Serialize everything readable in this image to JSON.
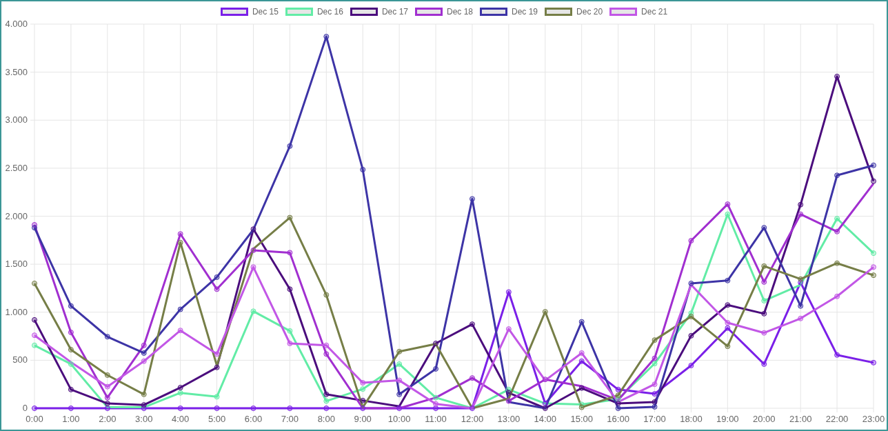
{
  "chart_data": {
    "type": "line",
    "grid": true,
    "categories": [
      "0:00",
      "1:00",
      "2:00",
      "3:00",
      "4:00",
      "5:00",
      "6:00",
      "7:00",
      "8:00",
      "9:00",
      "10:00",
      "11:00",
      "12:00",
      "13:00",
      "14:00",
      "15:00",
      "16:00",
      "17:00",
      "18:00",
      "19:00",
      "20:00",
      "21:00",
      "22:00",
      "23:00"
    ],
    "ylim": [
      0,
      4000
    ],
    "yticks": [
      {
        "value": 0,
        "label": "0"
      },
      {
        "value": 500,
        "label": "500"
      },
      {
        "value": 1000,
        "label": "1.000"
      },
      {
        "value": 1500,
        "label": "1.500"
      },
      {
        "value": 2000,
        "label": "2.000"
      },
      {
        "value": 2500,
        "label": "2.500"
      },
      {
        "value": 3000,
        "label": "3.000"
      },
      {
        "value": 3500,
        "label": "3.500"
      },
      {
        "value": 4000,
        "label": "4.000"
      }
    ],
    "series": [
      {
        "name": "Dec 15",
        "color": "#7a1fe8",
        "marker": "circle",
        "values": [
          0,
          0,
          0,
          0,
          0,
          0,
          0,
          0,
          0,
          0,
          0,
          0,
          0,
          1210,
          50,
          490,
          195,
          150,
          445,
          835,
          460,
          1310,
          555,
          475
        ]
      },
      {
        "name": "Dec 16",
        "color": "#62eca6",
        "marker": "circle",
        "values": [
          655,
          460,
          10,
          10,
          160,
          120,
          1010,
          805,
          75,
          200,
          460,
          110,
          0,
          195,
          50,
          40,
          95,
          465,
          990,
          2020,
          1120,
          1285,
          1975,
          1615
        ]
      },
      {
        "name": "Dec 17",
        "color": "#4b0d7d",
        "marker": "circle",
        "values": [
          920,
          195,
          50,
          35,
          215,
          425,
          1865,
          1240,
          145,
          80,
          20,
          675,
          875,
          160,
          0,
          210,
          50,
          65,
          755,
          1075,
          985,
          2120,
          3455,
          2365
        ]
      },
      {
        "name": "Dec 18",
        "color": "#a12fd0",
        "marker": "circle",
        "values": [
          1910,
          790,
          110,
          655,
          1815,
          1240,
          1645,
          1620,
          565,
          0,
          0,
          110,
          315,
          75,
          300,
          230,
          85,
          520,
          1745,
          2125,
          1315,
          2020,
          1840,
          2340
        ]
      },
      {
        "name": "Dec 19",
        "color": "#3d34a6",
        "marker": "circle",
        "values": [
          1880,
          1065,
          745,
          575,
          1030,
          1365,
          1860,
          2730,
          3870,
          2485,
          145,
          410,
          2180,
          65,
          0,
          900,
          0,
          15,
          1300,
          1330,
          1880,
          1065,
          2425,
          2530
        ]
      },
      {
        "name": "Dec 20",
        "color": "#767e47",
        "marker": "circle",
        "values": [
          1300,
          610,
          345,
          145,
          1725,
          445,
          1660,
          1985,
          1180,
          10,
          590,
          670,
          0,
          100,
          1005,
          10,
          135,
          710,
          955,
          645,
          1480,
          1345,
          1510,
          1385
        ]
      },
      {
        "name": "Dec 21",
        "color": "#c257e6",
        "marker": "circle",
        "values": [
          760,
          480,
          225,
          490,
          810,
          565,
          1470,
          675,
          655,
          265,
          290,
          45,
          0,
          825,
          290,
          575,
          65,
          250,
          1285,
          890,
          785,
          935,
          1165,
          1470
        ]
      }
    ]
  }
}
